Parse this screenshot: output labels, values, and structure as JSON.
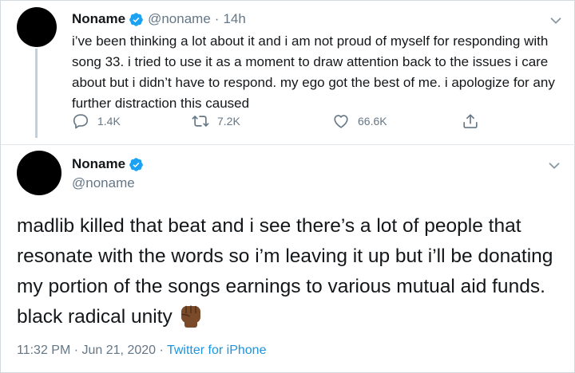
{
  "tweet1": {
    "name": "Noname",
    "handle": "@noname",
    "separator": "·",
    "time": "14h",
    "text": "i’ve been thinking a lot about it and i am not proud of myself for responding with song 33. i tried to use it as a moment to draw attention back to the issues i care about but i didn’t have to respond. my ego got the best of me. i apologize for any further distraction this caused",
    "replies": "1.4K",
    "retweets": "7.2K",
    "likes": "66.6K"
  },
  "tweet2": {
    "name": "Noname",
    "handle": "@noname",
    "text": "madlib killed that beat and i see there’s a lot of people that resonate with the words so i’m leaving it up but i’ll be donating my portion of the songs earnings to various mutual aid funds. black radical unity",
    "emoji": "raised-fist-emoji",
    "timestamp": "11:32 PM · Jun 21, 2020 · ",
    "source": "Twitter for iPhone"
  },
  "colors": {
    "verified": "#1da1f2",
    "secondary_text": "#657786",
    "link": "#1b95e0",
    "fist": "#7a4b2a"
  },
  "icons": [
    "verified-badge-icon",
    "chevron-down-icon",
    "reply-icon",
    "retweet-icon",
    "like-icon",
    "share-icon"
  ]
}
